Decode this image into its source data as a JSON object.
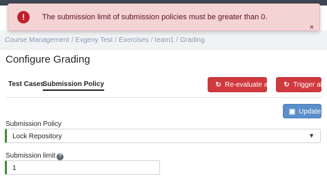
{
  "alert": {
    "message": "The submission limit of submission policies must be greater than 0.",
    "icon": "exclamation-circle-icon",
    "color": "#c0202c"
  },
  "breadcrumb": [
    "Course Management",
    "Evgeny Test",
    "Exercises",
    "team1",
    "Grading"
  ],
  "page": {
    "title": "Configure Grading"
  },
  "tabs": [
    {
      "label": "Test Cases",
      "active": false
    },
    {
      "label": "Submission Policy",
      "active": true
    }
  ],
  "actions": {
    "reevaluate_label": "Re-evaluate all",
    "trigger_label": "Trigger all",
    "update_label": "Update",
    "danger_color": "#d0393e",
    "primary_color": "#5b8ecb"
  },
  "form": {
    "policy_label": "Submission Policy",
    "policy_value": "Lock Repository",
    "limit_label": "Submission limit",
    "limit_value": "1"
  }
}
